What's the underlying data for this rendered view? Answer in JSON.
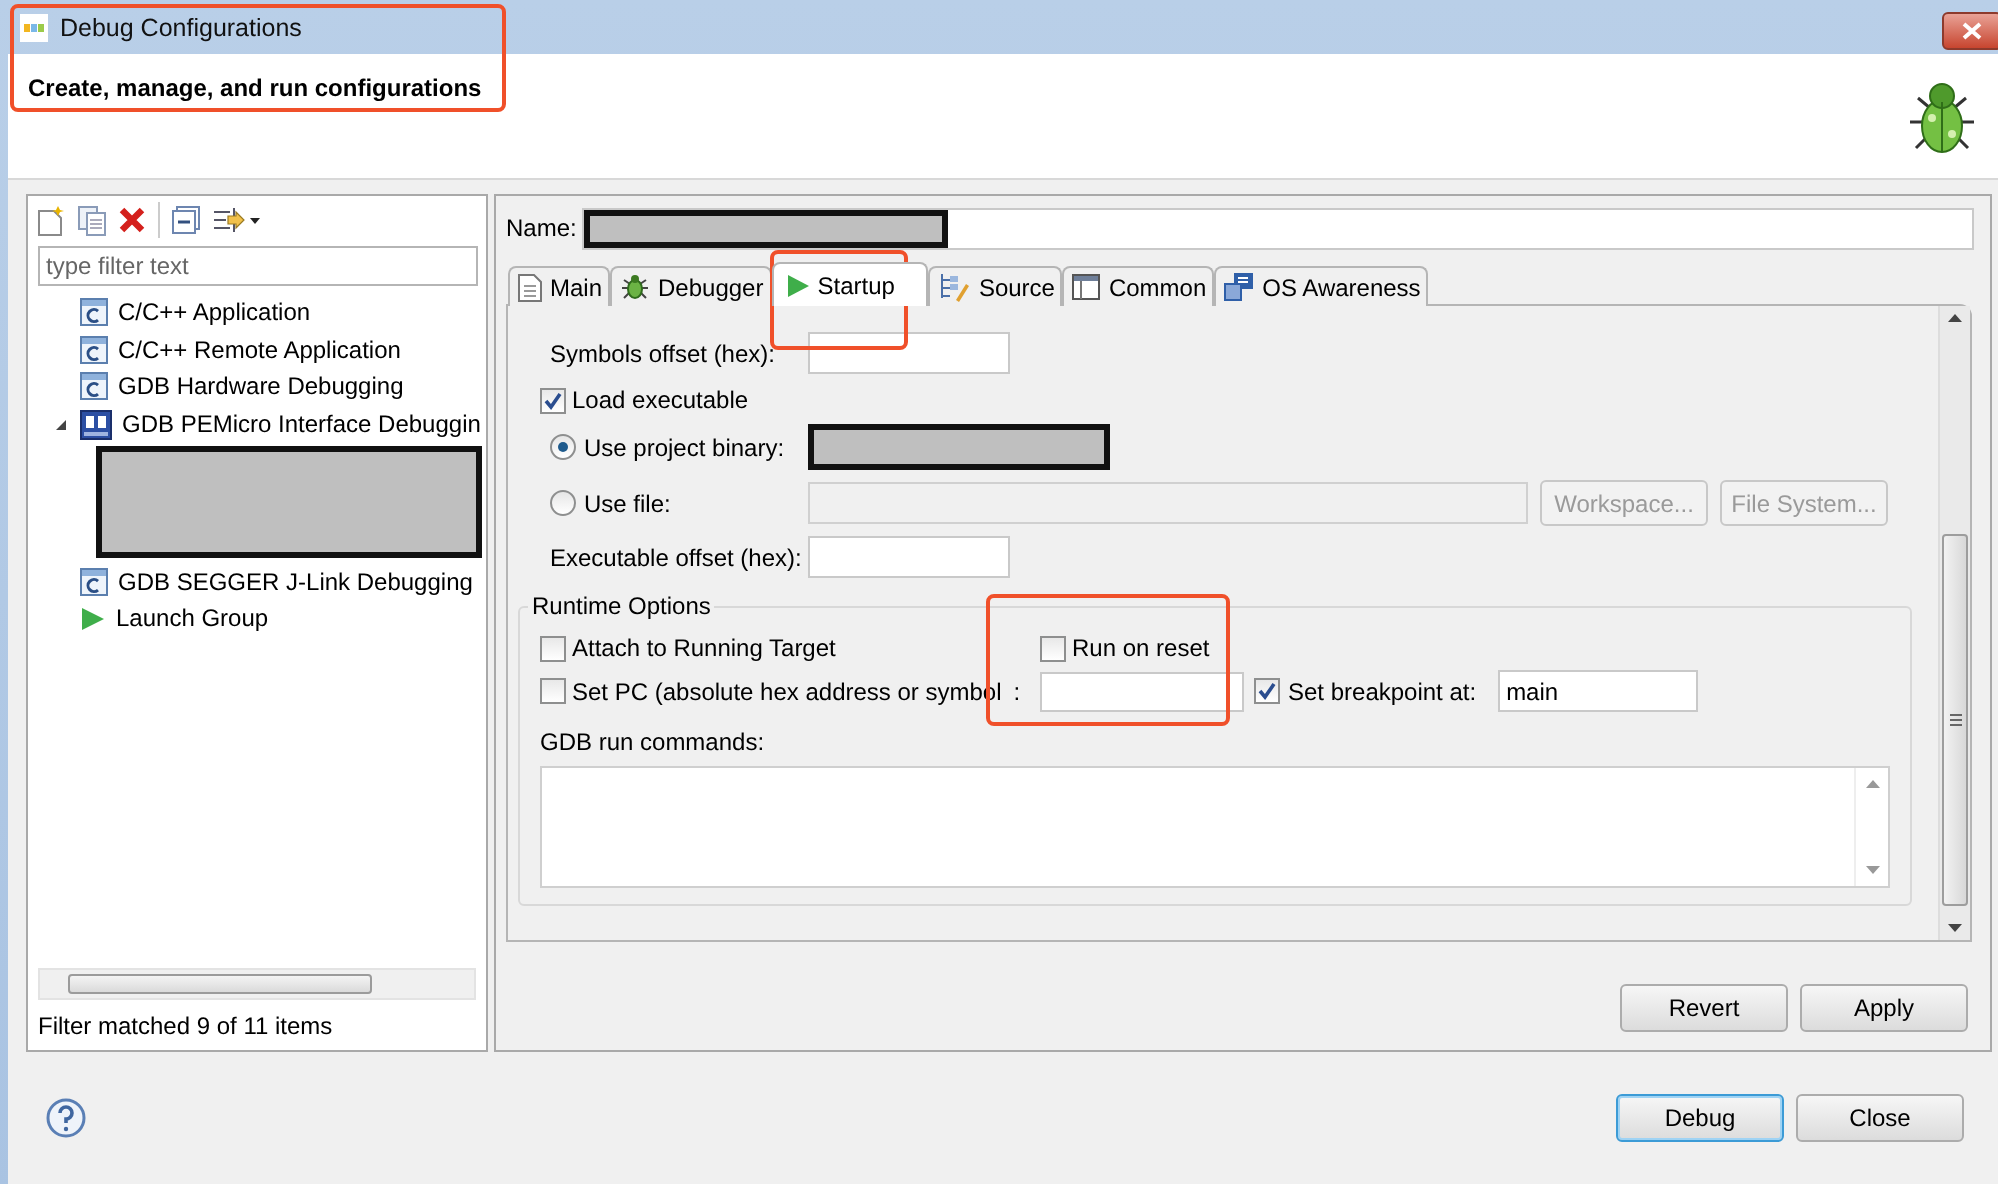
{
  "window": {
    "title": "Debug Configurations"
  },
  "header": {
    "subtitle": "Create, manage, and run configurations",
    "highlighted": true
  },
  "sidebar": {
    "filter": {
      "placeholder": "type filter text"
    },
    "tree": [
      {
        "label": "C/C++ Application",
        "kind": "c"
      },
      {
        "label": "C/C++ Remote Application",
        "kind": "c"
      },
      {
        "label": "GDB Hardware Debugging",
        "kind": "c"
      },
      {
        "label": "GDB PEMicro Interface Debuggin",
        "kind": "pe",
        "expanded": true,
        "children": [
          {
            "redacted": true
          }
        ]
      },
      {
        "label": "GDB SEGGER J-Link Debugging",
        "kind": "c"
      },
      {
        "label": "Launch Group",
        "kind": "launch"
      }
    ],
    "status": "Filter matched 9 of 11 items"
  },
  "config": {
    "name": {
      "label": "Name:",
      "redacted": true
    },
    "tabs": [
      {
        "label": "Main",
        "kind": "document",
        "selected": false,
        "highlighted": false
      },
      {
        "label": "Debugger",
        "kind": "bug",
        "selected": false,
        "highlighted": false
      },
      {
        "label": "Startup",
        "kind": "play",
        "selected": true,
        "highlighted": true
      },
      {
        "label": "Source",
        "kind": "source",
        "selected": false,
        "highlighted": false
      },
      {
        "label": "Common",
        "kind": "table",
        "selected": false,
        "highlighted": false
      },
      {
        "label": "OS Awareness",
        "kind": "os",
        "selected": false,
        "highlighted": false
      }
    ],
    "startup": {
      "symbols_offset": {
        "label": "Symbols offset (hex):"
      },
      "load_executable": {
        "label": "Load executable",
        "checked": true
      },
      "binary_source": [
        {
          "label": "Use project binary:",
          "kind": "project",
          "selected": true,
          "redacted": true
        },
        {
          "label": "Use file:",
          "kind": "file",
          "selected": false,
          "disabled": true,
          "buttons": [
            "Workspace...",
            "File System..."
          ]
        }
      ],
      "executable_offset": {
        "label": "Executable offset (hex):"
      },
      "runtime": {
        "title": "Runtime Options",
        "options": [
          {
            "label": "Attach to Running Target",
            "checked": false,
            "highlighted": false
          },
          {
            "label": "Run on reset",
            "checked": false,
            "highlighted": true
          }
        ],
        "set_pc": {
          "label": "Set PC (absolute hex address or symbol",
          "suffix": ":",
          "checked": false
        },
        "breakpoint": {
          "label": "Set breakpoint at:",
          "checked": true,
          "value": "main"
        },
        "commands": {
          "label": "GDB run commands:"
        }
      }
    },
    "actions": [
      "Revert",
      "Apply"
    ]
  },
  "footer": {
    "buttons": [
      {
        "label": "Debug",
        "default": true
      },
      {
        "label": "Close",
        "default": false
      }
    ]
  }
}
